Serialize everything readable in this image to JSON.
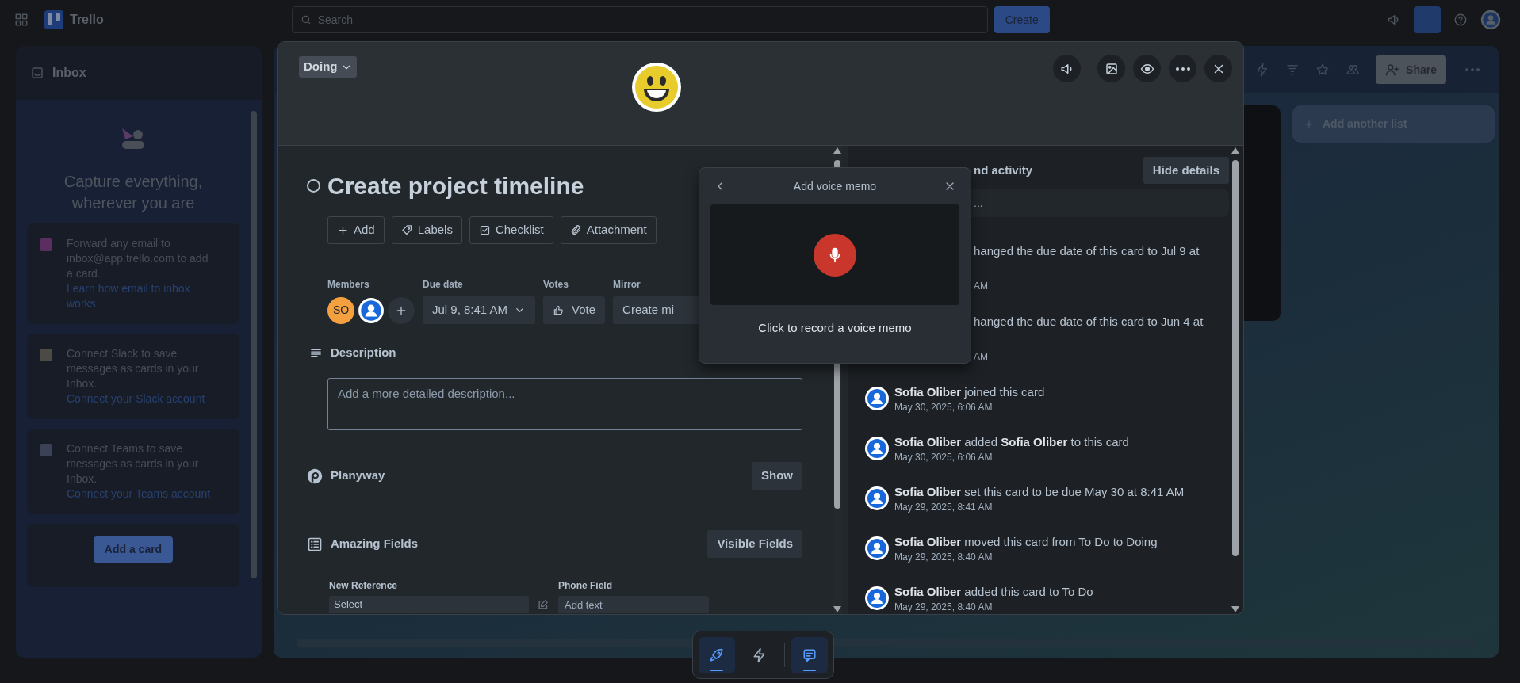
{
  "top_bar": {
    "logo": "Trello",
    "search": {
      "placeholder": "Search"
    },
    "create_button": "Create"
  },
  "inbox": {
    "title": "Inbox",
    "heading": "Capture everything, wherever you are",
    "items": [
      {
        "kind": "email",
        "text": "Forward any email to inbox@app.trello.com to add a card.",
        "link": "Learn how email to inbox works"
      },
      {
        "kind": "slack",
        "text": "Connect Slack to save messages as cards in your Inbox.",
        "link": "Connect your Slack account"
      },
      {
        "kind": "teams",
        "text": "Connect Teams to save messages as cards in your Inbox.",
        "link": "Connect your Teams account"
      }
    ],
    "add_button": "Add a card"
  },
  "board": {
    "share_button": "Share",
    "add_list_button": "Add another list"
  },
  "card": {
    "list_button": "Doing",
    "title": "Create project timeline",
    "completed": false,
    "actions": [
      {
        "kind": "add",
        "label": "Add"
      },
      {
        "kind": "labels",
        "label": "Labels"
      },
      {
        "kind": "checklist",
        "label": "Checklist"
      },
      {
        "kind": "attachment",
        "label": "Attachment"
      }
    ],
    "members_label": "Members",
    "members": [
      {
        "kind": "initials",
        "initials": "SO"
      },
      {
        "kind": "avatar"
      }
    ],
    "due_date": {
      "label": "Due date",
      "value": "Jul 9, 8:41 AM"
    },
    "votes": {
      "label": "Votes",
      "button": "Vote"
    },
    "mirror": {
      "label": "Mirror",
      "button": "Create mi"
    },
    "description": {
      "title": "Description",
      "placeholder": "Add a more detailed description..."
    },
    "planyway": {
      "title": "Planyway",
      "button": "Show"
    },
    "fields_section": {
      "title": "Amazing Fields",
      "button": "Visible Fields",
      "fields": [
        {
          "kind": "select",
          "label": "New Reference",
          "value": "Select"
        },
        {
          "kind": "text",
          "label": "Phone Field",
          "placeholder": "Add text"
        }
      ]
    }
  },
  "activity": {
    "title": "nd activity",
    "hide_button": "Hide details",
    "comment_placeholder": "...",
    "entries": [
      {
        "kind": "partial",
        "text": "hanged the due date of this card to Jul 9 at",
        "time": "AM"
      },
      {
        "kind": "partial",
        "text": "hanged the due date of this card to Jun 4 at",
        "time": "AM"
      },
      {
        "kind": "full",
        "text": "**Sofia Oliber** joined this card",
        "time": "May 30, 2025, 6:06 AM"
      },
      {
        "kind": "full",
        "text": "**Sofia Oliber** added **Sofia Oliber** to this card",
        "time": "May 30, 2025, 6:06 AM"
      },
      {
        "kind": "full",
        "text": "**Sofia Oliber** set this card to be due May 30 at 8:41 AM",
        "time": "May 29, 2025, 8:41 AM"
      },
      {
        "kind": "full",
        "text": "**Sofia Oliber** moved this card from To Do to Doing",
        "time": "May 29, 2025, 8:40 AM"
      },
      {
        "kind": "full",
        "text": "**Sofia Oliber** added this card to To Do",
        "time": "May 29, 2025, 8:40 AM"
      }
    ]
  },
  "voice_memo": {
    "title": "Add voice memo",
    "hint": "Click to record a voice memo"
  },
  "dock": [
    {
      "kind": "rocket",
      "selected": true
    },
    {
      "kind": "bolt",
      "selected": false
    },
    {
      "kind": "chat",
      "selected": true
    }
  ]
}
